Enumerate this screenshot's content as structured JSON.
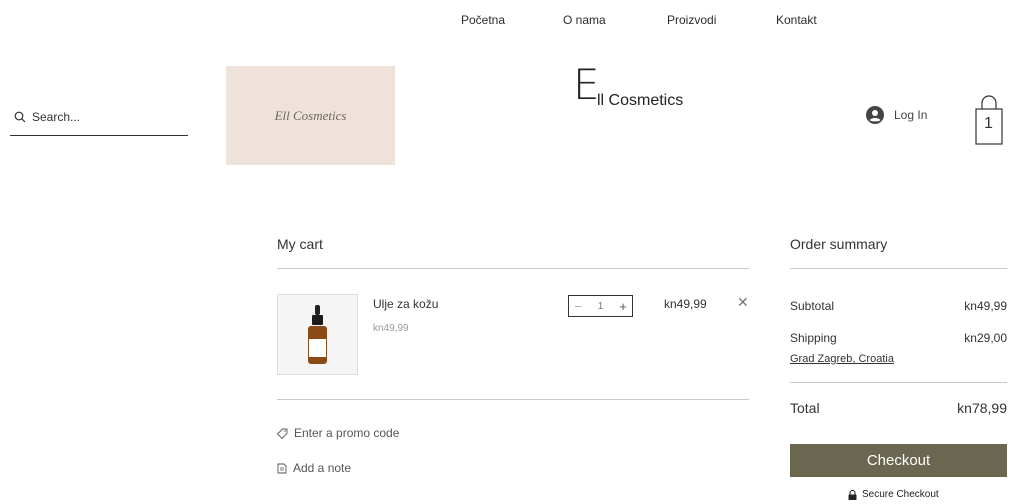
{
  "nav": {
    "items": [
      "Početna",
      "O nama",
      "Proizvodi",
      "Kontakt"
    ]
  },
  "search": {
    "placeholder": "Search..."
  },
  "logo": {
    "text": "Ell Cosmetics"
  },
  "brand": {
    "initial": "E",
    "rest": "ll Cosmetics"
  },
  "account": {
    "login_label": "Log In"
  },
  "cart_icon": {
    "count": "1"
  },
  "cart": {
    "title": "My cart",
    "item": {
      "name": "Ulje za kožu",
      "unit_price": "kn49,99",
      "quantity": "1",
      "line_total": "kn49,99",
      "remove_symbol": "✕"
    },
    "promo_label": "Enter a promo code",
    "note_label": "Add a note"
  },
  "summary": {
    "title": "Order summary",
    "subtotal_label": "Subtotal",
    "subtotal_value": "kn49,99",
    "shipping_label": "Shipping",
    "shipping_value": "kn29,00",
    "location": "Grad Zagreb, Croatia",
    "total_label": "Total",
    "total_value": "kn78,99",
    "checkout_label": "Checkout",
    "secure_label": "Secure Checkout"
  },
  "colors": {
    "checkout_bg": "#6a6650",
    "logo_bg": "#efe2da"
  }
}
